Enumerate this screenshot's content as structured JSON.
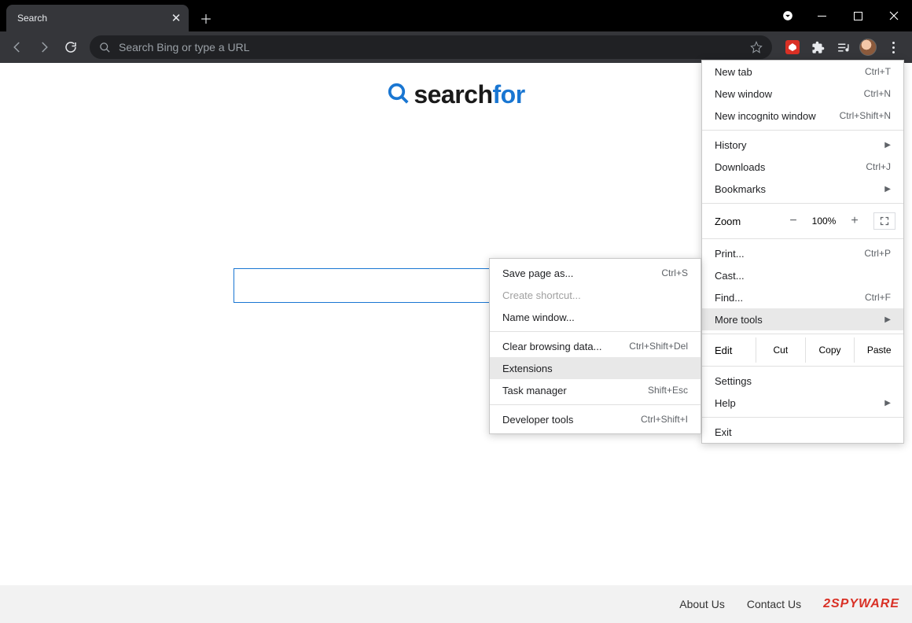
{
  "window": {
    "tab_title": "Search"
  },
  "toolbar": {
    "omnibox_placeholder": "Search Bing or type a URL"
  },
  "page": {
    "logo_part1": "search",
    "logo_part2": "for"
  },
  "footer": {
    "about": "About Us",
    "contact": "Contact Us",
    "watermark_prefix": "2",
    "watermark_text": "SPYWARE"
  },
  "menu": {
    "new_tab": {
      "label": "New tab",
      "shortcut": "Ctrl+T"
    },
    "new_window": {
      "label": "New window",
      "shortcut": "Ctrl+N"
    },
    "new_incognito": {
      "label": "New incognito window",
      "shortcut": "Ctrl+Shift+N"
    },
    "history": {
      "label": "History"
    },
    "downloads": {
      "label": "Downloads",
      "shortcut": "Ctrl+J"
    },
    "bookmarks": {
      "label": "Bookmarks"
    },
    "zoom": {
      "label": "Zoom",
      "value": "100%"
    },
    "print": {
      "label": "Print...",
      "shortcut": "Ctrl+P"
    },
    "cast": {
      "label": "Cast..."
    },
    "find": {
      "label": "Find...",
      "shortcut": "Ctrl+F"
    },
    "more_tools": {
      "label": "More tools"
    },
    "edit": {
      "label": "Edit",
      "cut": "Cut",
      "copy": "Copy",
      "paste": "Paste"
    },
    "settings": {
      "label": "Settings"
    },
    "help": {
      "label": "Help"
    },
    "exit": {
      "label": "Exit"
    }
  },
  "submenu": {
    "save_page": {
      "label": "Save page as...",
      "shortcut": "Ctrl+S"
    },
    "create_shortcut": {
      "label": "Create shortcut..."
    },
    "name_window": {
      "label": "Name window..."
    },
    "clear_data": {
      "label": "Clear browsing data...",
      "shortcut": "Ctrl+Shift+Del"
    },
    "extensions": {
      "label": "Extensions"
    },
    "task_manager": {
      "label": "Task manager",
      "shortcut": "Shift+Esc"
    },
    "dev_tools": {
      "label": "Developer tools",
      "shortcut": "Ctrl+Shift+I"
    }
  }
}
